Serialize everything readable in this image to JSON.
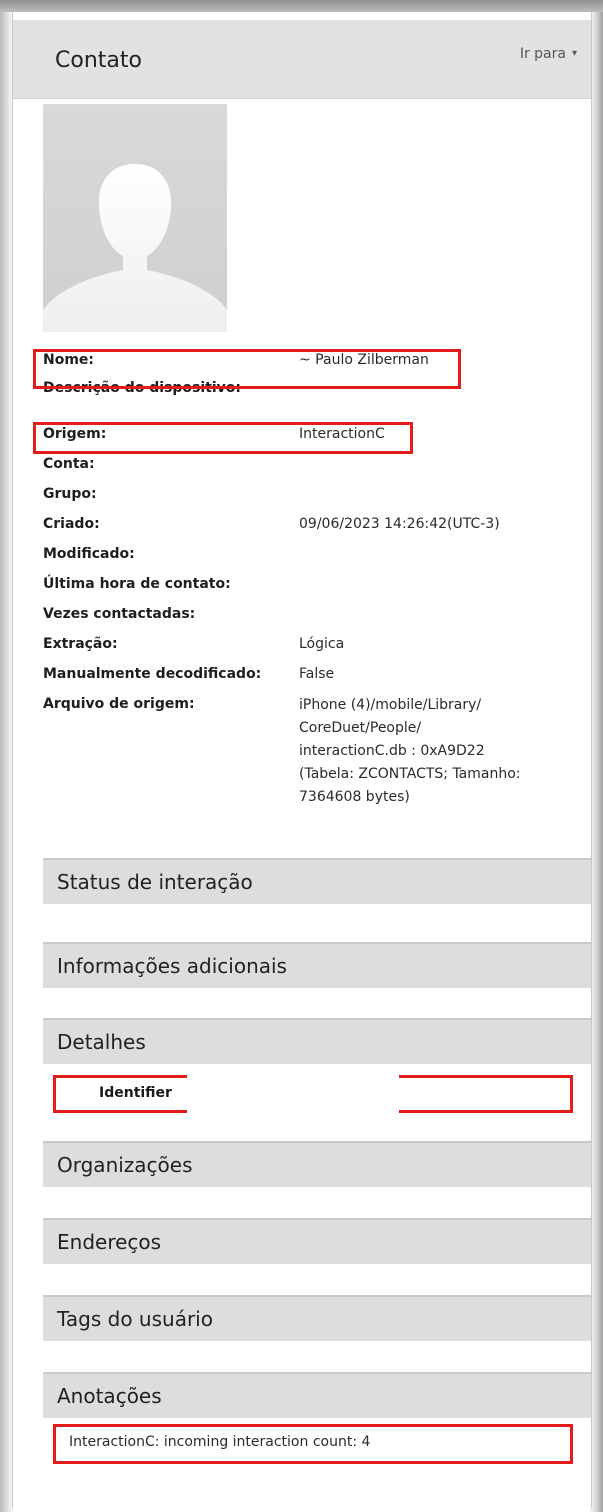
{
  "header": {
    "title": "Contato",
    "goto_label": "Ir para",
    "goto_chevron": "▾"
  },
  "fields": [
    {
      "label": "Nome:",
      "value": "~ Paulo Zilberman"
    },
    {
      "label": "Descrição do dispositivo:",
      "value": ""
    },
    {
      "label": "Origem:",
      "value": "InteractionC"
    },
    {
      "label": "Conta:",
      "value": ""
    },
    {
      "label": "Grupo:",
      "value": ""
    },
    {
      "label": "Criado:",
      "value": "09/06/2023 14:26:42(UTC-3)"
    },
    {
      "label": "Modificado:",
      "value": ""
    },
    {
      "label": "Última hora de contato:",
      "value": ""
    },
    {
      "label": "Vezes contactadas:",
      "value": ""
    },
    {
      "label": "Extração:",
      "value": "Lógica"
    },
    {
      "label": "Manualmente decodificado:",
      "value": "False"
    },
    {
      "label": "Arquivo de origem:",
      "value_lines": [
        "iPhone (4)/mobile/Library/",
        "CoreDuet/People/",
        "interactionC.db : 0xA9D22",
        "(Tabela: ZCONTACTS; Tamanho:",
        "7364608 bytes)"
      ]
    }
  ],
  "sections": {
    "status": "Status de interação",
    "info": "Informações adicionais",
    "details": "Detalhes",
    "details_row": "Identifier",
    "orgs": "Organizações",
    "addresses": "Endereços",
    "tags": "Tags do usuário",
    "notes": "Anotações",
    "notes_row": "InteractionC: incoming interaction count:  4"
  },
  "colors": {
    "highlight": "#e31b1b",
    "section_bg": "#dddddd",
    "header_bg": "#e2e2e2"
  }
}
